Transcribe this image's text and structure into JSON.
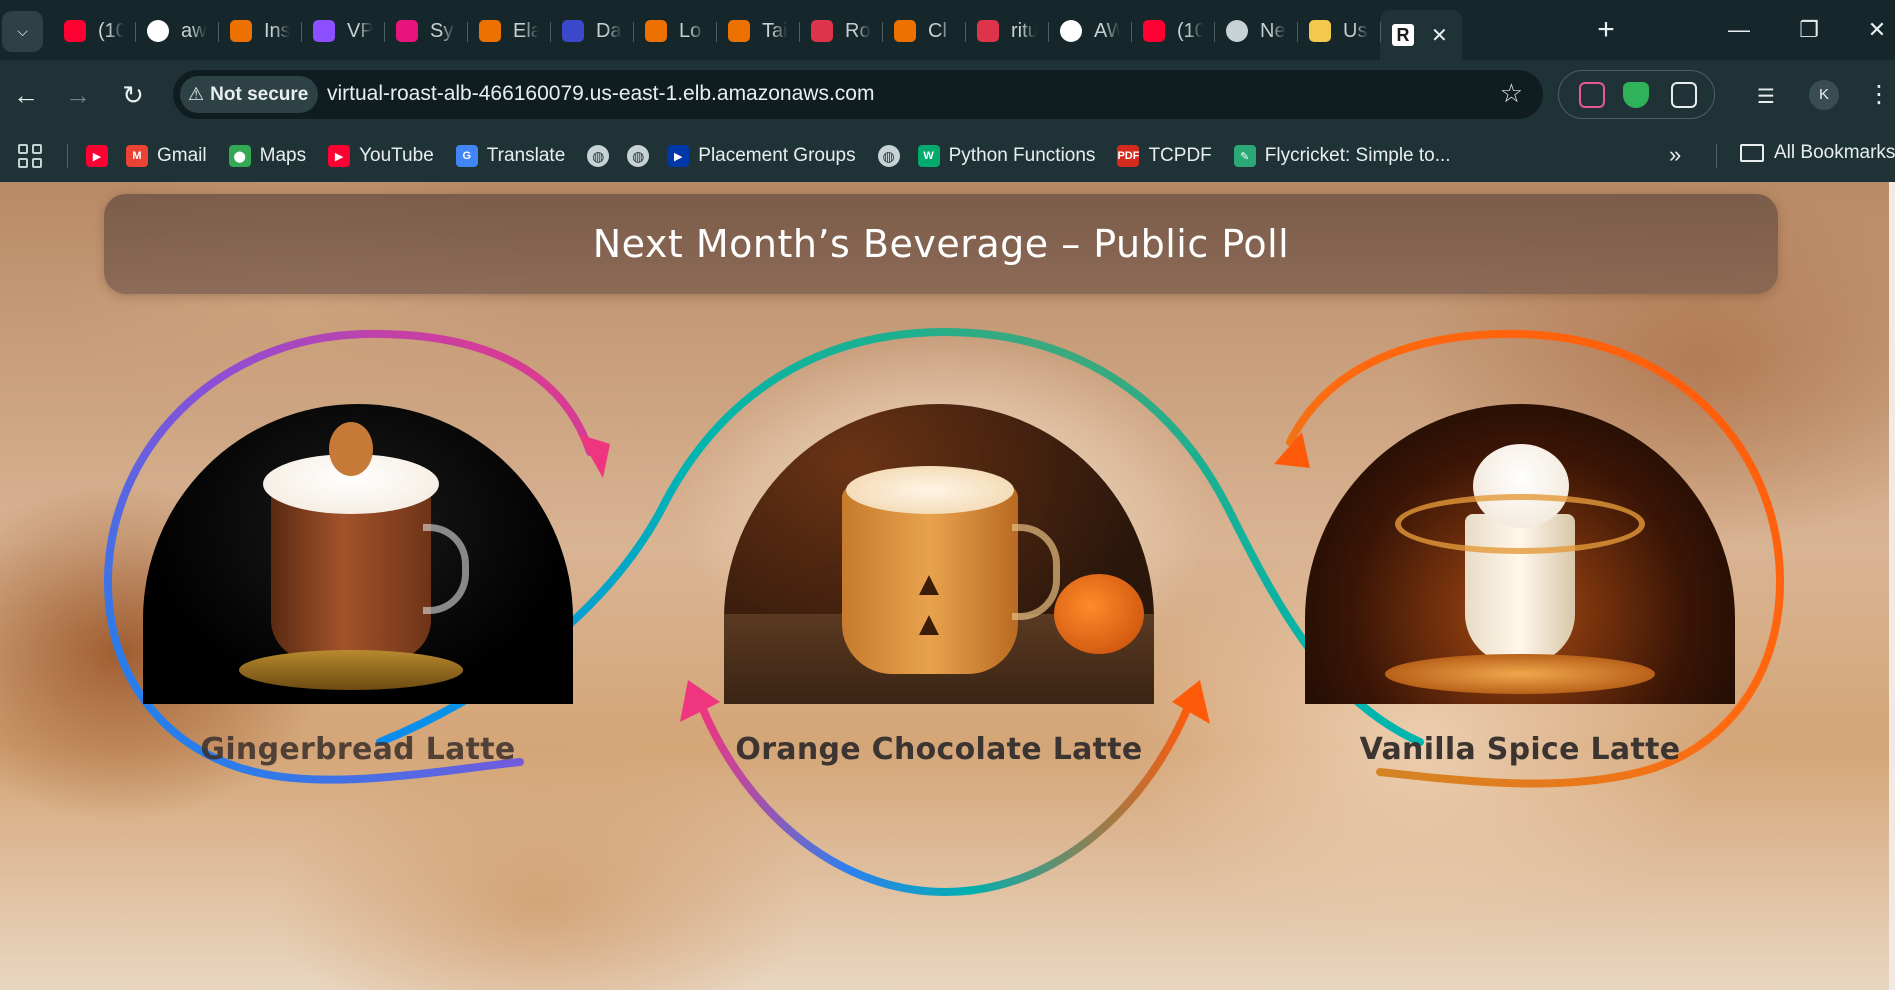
{
  "browser": {
    "tabs": [
      {
        "icon": "youtube-icon",
        "title": "(10",
        "color": "#ff0033"
      },
      {
        "icon": "github-icon",
        "title": "aw",
        "color": "#ffffff"
      },
      {
        "icon": "aws-icon",
        "title": "Ins",
        "color": "#ed7100"
      },
      {
        "icon": "aws-vpc-icon",
        "title": "VP",
        "color": "#8c4fff"
      },
      {
        "icon": "aws-systems-manager-icon",
        "title": "Sy",
        "color": "#e7157b"
      },
      {
        "icon": "aws-elastic-icon",
        "title": "Ela",
        "color": "#ed7100"
      },
      {
        "icon": "aws-database-icon",
        "title": "Da",
        "color": "#3b48cc"
      },
      {
        "icon": "aws-icon",
        "title": "Lo",
        "color": "#ed7100"
      },
      {
        "icon": "aws-icon",
        "title": "Tai",
        "color": "#ed7100"
      },
      {
        "icon": "aws-route53-icon",
        "title": "Ro",
        "color": "#dd344c"
      },
      {
        "icon": "aws-cloud-icon",
        "title": "Cl",
        "color": "#ed7100"
      },
      {
        "icon": "aws-settings-icon",
        "title": "ritu",
        "color": "#dd344c"
      },
      {
        "icon": "github-icon",
        "title": "AW",
        "color": "#ffffff"
      },
      {
        "icon": "youtube-icon",
        "title": "(10",
        "color": "#ff0033"
      },
      {
        "icon": "chrome-icon",
        "title": "Ne",
        "color": "#c7d2d4"
      },
      {
        "icon": "file-icon",
        "title": "Us",
        "color": "#f2c94c"
      }
    ],
    "active_tab": {
      "icon": "r-logo-icon",
      "letter": "R",
      "close": "✕"
    },
    "new_tab": "+",
    "window": {
      "minimize": "—",
      "restore": "❐",
      "close": "✕"
    },
    "security_label": "Not secure",
    "url": "virtual-roast-alb-466160079.us-east-1.elb.amazonaws.com",
    "profile_initial": "K",
    "bookmarks": [
      {
        "label": "",
        "icon": "youtube-icon",
        "color": "#ff0033",
        "glyph": "▶"
      },
      {
        "label": "Gmail",
        "icon": "gmail-icon",
        "color": "#ea4335",
        "glyph": "M"
      },
      {
        "label": "Maps",
        "icon": "maps-icon",
        "color": "#34a853",
        "glyph": "⬤"
      },
      {
        "label": "YouTube",
        "icon": "youtube-icon",
        "color": "#ff0033",
        "glyph": "▶"
      },
      {
        "label": "Translate",
        "icon": "translate-icon",
        "color": "#4285f4",
        "glyph": "G"
      },
      {
        "label": "",
        "icon": "globe-icon",
        "color": "",
        "glyph": "◍"
      },
      {
        "label": "",
        "icon": "globe-icon",
        "color": "",
        "glyph": "◍"
      },
      {
        "label": "Placement Groups",
        "icon": "flag-icon",
        "color": "#0038a8",
        "glyph": "▶"
      },
      {
        "label": "",
        "icon": "globe-icon",
        "color": "",
        "glyph": "◍"
      },
      {
        "label": "Python Functions",
        "icon": "w3schools-icon",
        "color": "#04aa6d",
        "glyph": "W"
      },
      {
        "label": "TCPDF",
        "icon": "pdf-icon",
        "color": "#d52b1e",
        "glyph": "PDF"
      },
      {
        "label": "Flycricket: Simple to...",
        "icon": "flycricket-icon",
        "color": "#2aa876",
        "glyph": "✎"
      }
    ],
    "more_bookmarks": "»",
    "all_bookmarks": "All Bookmarks"
  },
  "page": {
    "title": "Next Month’s Beverage – Public Poll",
    "drinks": [
      {
        "name": "Gingerbread Latte"
      },
      {
        "name": "Orange Chocolate Latte"
      },
      {
        "name": "Vanilla Spice Latte"
      }
    ]
  }
}
